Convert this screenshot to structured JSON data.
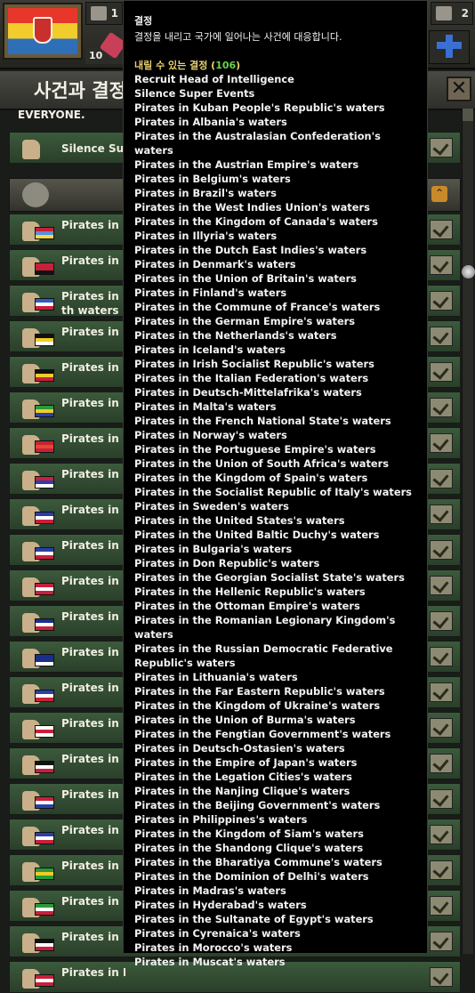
{
  "hud": {
    "resource_left": {
      "icon": "factory-icon",
      "value": "1"
    },
    "resource_right": {
      "icon": "stockpile-icon",
      "value": "2"
    },
    "badge": "10"
  },
  "panel": {
    "title": "사건과 결정",
    "subtitle": "EVERYONE.",
    "close_icon": "close-icon",
    "rows": [
      {
        "label": "Silence Sup",
        "flag": "none",
        "icon": "silence-icon"
      },
      {
        "label": "Pirates in K",
        "flag": [
          "#c8203a",
          "#5a8fd8",
          "#f2d84a"
        ]
      },
      {
        "label": "Pirates in A",
        "flag": [
          "#c8203a",
          "#c8203a",
          "#111111"
        ]
      },
      {
        "label": "Pirates in th waters",
        "flag": [
          "#2d5dbf",
          "#ffffff",
          "#c8203a"
        ]
      },
      {
        "label": "Pirates in th",
        "flag": [
          "#111111",
          "#f2cc2a",
          "#ffffff"
        ]
      },
      {
        "label": "Pirates in B",
        "flag": [
          "#111111",
          "#f2cc2a",
          "#c8203a"
        ]
      },
      {
        "label": "Pirates in B",
        "flag": [
          "#2a9a3a",
          "#f2cc2a",
          "#2a3fa8"
        ]
      },
      {
        "label": "Pirates in th",
        "flag": [
          "#c8203a",
          "#e24a2a",
          "#c8203a"
        ]
      },
      {
        "label": "Pirates in th",
        "flag": [
          "#c8203a",
          "#2a3fa8",
          "#ffffff"
        ]
      },
      {
        "label": "Pirates in Il",
        "flag": [
          "#2a3fa8",
          "#ffffff",
          "#c8203a"
        ]
      },
      {
        "label": "Pirates in th",
        "flag": [
          "#2a3fa8",
          "#ffffff",
          "#c8203a"
        ]
      },
      {
        "label": "Pirates in D",
        "flag": [
          "#c8203a",
          "#ffffff",
          "#c8203a"
        ]
      },
      {
        "label": "Pirates in th",
        "flag": [
          "#1a2f8a",
          "#ffffff",
          "#c8203a"
        ]
      },
      {
        "label": "Pirates in Fi",
        "flag": [
          "#1a2f8a",
          "#1a2f8a",
          "#ffffff"
        ]
      },
      {
        "label": "Pirates in th",
        "flag": [
          "#2a3fa8",
          "#ffffff",
          "#c8203a"
        ]
      },
      {
        "label": "Pirates in th",
        "flag": [
          "#ffffff",
          "#c8203a",
          "#ffffff"
        ]
      },
      {
        "label": "Pirates in th",
        "flag": [
          "#111111",
          "#ffffff",
          "#c8203a"
        ]
      },
      {
        "label": "Pirates in th",
        "flag": [
          "#c8203a",
          "#ffffff",
          "#2a3fa8"
        ]
      },
      {
        "label": "Pirates in Ic",
        "flag": [
          "#2a3fa8",
          "#ffffff",
          "#c8203a"
        ]
      },
      {
        "label": "Pirates in Ir",
        "flag": [
          "#2a9a3a",
          "#f2cc2a",
          "#2a9a3a"
        ]
      },
      {
        "label": "Pirates in th",
        "flag": [
          "#2a9a3a",
          "#ffffff",
          "#c8203a"
        ]
      },
      {
        "label": "Pirates in D",
        "flag": [
          "#111111",
          "#ffffff",
          "#c8203a"
        ]
      },
      {
        "label": "Pirates in M",
        "flag": [
          "#c8203a",
          "#ffffff",
          "#c8203a"
        ]
      }
    ]
  },
  "tooltip": {
    "title": "결정",
    "description": "결정을 내리고 국가에 일어나는 사건에 대응합니다.",
    "count_label": "내릴 수 있는 결정 (",
    "count_value": "106",
    "count_close": ")",
    "items": [
      "Recruit Head of Intelligence",
      "Silence Super Events",
      "Pirates in Kuban People's Republic's waters",
      "Pirates in Albania's waters",
      "Pirates in the Australasian Confederation's waters",
      "Pirates in the Austrian Empire's waters",
      "Pirates in Belgium's waters",
      "Pirates in Brazil's waters",
      "Pirates in the West Indies Union's waters",
      "Pirates in the Kingdom of Canada's waters",
      "Pirates in Illyria's waters",
      "Pirates in the Dutch East Indies's waters",
      "Pirates in Denmark's waters",
      "Pirates in the Union of Britain's waters",
      "Pirates in Finland's waters",
      "Pirates in the Commune of France's waters",
      "Pirates in the German Empire's waters",
      "Pirates in the Netherlands's waters",
      "Pirates in Iceland's waters",
      "Pirates in Irish Socialist Republic's waters",
      "Pirates in the Italian Federation's waters",
      "Pirates in Deutsch-Mittelafrika's waters",
      "Pirates in Malta's waters",
      "Pirates in the French National State's waters",
      "Pirates in Norway's waters",
      "Pirates in the Portuguese Empire's waters",
      "Pirates in the Union of South Africa's waters",
      "Pirates in the Kingdom of Spain's waters",
      "Pirates in the Socialist Republic of Italy's waters",
      "Pirates in Sweden's waters",
      "Pirates in the United States's waters",
      "Pirates in the United Baltic Duchy's waters",
      "Pirates in Bulgaria's waters",
      "Pirates in Don Republic's waters",
      "Pirates in the Georgian Socialist State's waters",
      "Pirates in the Hellenic Republic's waters",
      "Pirates in the Ottoman Empire's waters",
      "Pirates in the Romanian Legionary Kingdom's waters",
      "Pirates in the Russian Democratic Federative Republic's waters",
      "Pirates in Lithuania's waters",
      "Pirates in the Far Eastern Republic's waters",
      "Pirates in the Kingdom of Ukraine's waters",
      "Pirates in the Union of Burma's waters",
      "Pirates in the Fengtian Government's waters",
      "Pirates in Deutsch-Ostasien's waters",
      "Pirates in the Empire of Japan's waters",
      "Pirates in the Legation Cities's waters",
      "Pirates in the Nanjing Clique's waters",
      "Pirates in the Beijing Government's waters",
      "Pirates in Philippines's waters",
      "Pirates in the Kingdom of Siam's waters",
      "Pirates in the Shandong Clique's waters",
      "Pirates in the Bharatiya Commune's waters",
      "Pirates in the Dominion of Delhi's waters",
      "Pirates in Madras's waters",
      "Pirates in Hyderabad's waters",
      "Pirates in the Sultanate of Egypt's waters",
      "Pirates in Cyrenaica's waters",
      "Pirates in Morocco's waters",
      "Pirates in Muscat's waters"
    ]
  }
}
